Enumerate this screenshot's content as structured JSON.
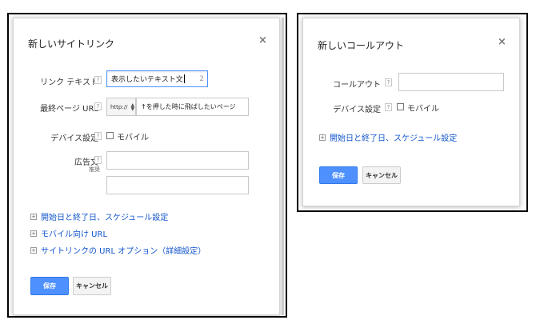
{
  "sitelink_dialog": {
    "title": "新しいサイトリンク",
    "link_text": {
      "label": "リンク テキスト",
      "value": "表示したいテキスト文",
      "char_count": "2"
    },
    "final_url": {
      "label": "最終ページ URL",
      "protocol": "http://",
      "value": "↑を押した時に飛ばしたいページ"
    },
    "device": {
      "label": "デバイス設定",
      "checkbox_label": "モバイル",
      "checked": false
    },
    "ad_text": {
      "label": "広告文",
      "sub_label": "推奨",
      "line1": "",
      "line2": ""
    },
    "expanders": [
      "開始日と終了日、スケジュール設定",
      "モバイル向け URL",
      "サイトリンクの URL オプション（詳細設定）"
    ],
    "save_label": "保存",
    "cancel_label": "キャンセル",
    "help_glyph": "?"
  },
  "callout_dialog": {
    "title": "新しいコールアウト",
    "callout": {
      "label": "コールアウト",
      "value": ""
    },
    "device": {
      "label": "デバイス設定",
      "checkbox_label": "モバイル",
      "checked": false
    },
    "expander": "開始日と終了日、スケジュール設定",
    "save_label": "保存",
    "cancel_label": "キャンセル"
  },
  "colors": {
    "primary_button": "#4d90fe",
    "link": "#1155cc",
    "focus_border": "#4d90fe"
  }
}
